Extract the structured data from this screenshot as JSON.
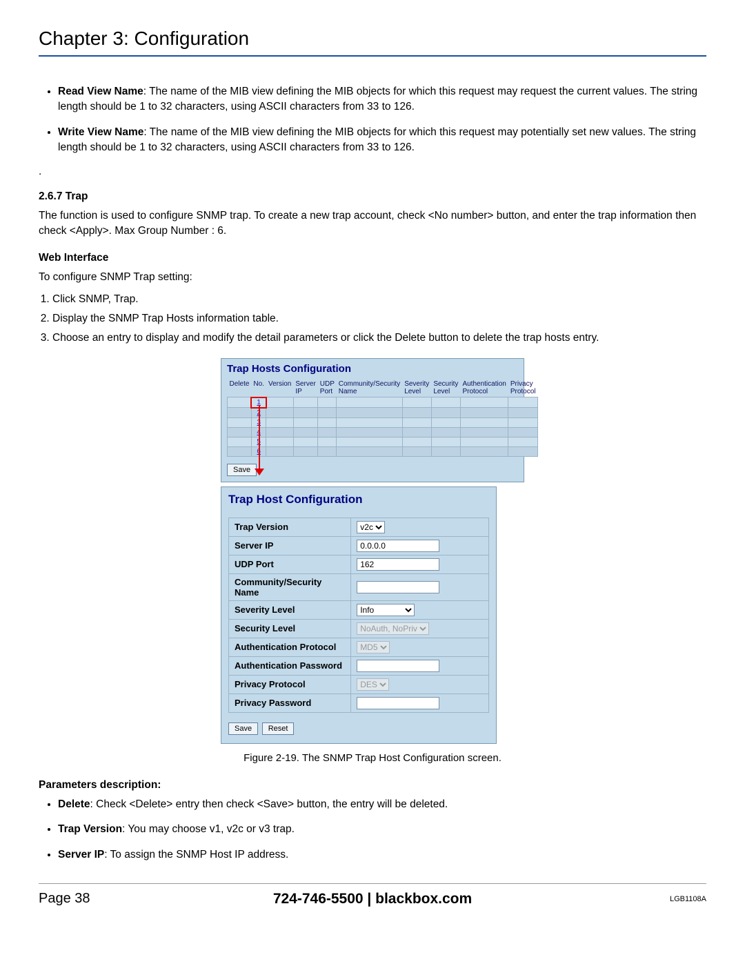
{
  "header": {
    "title": "Chapter 3: Configuration"
  },
  "bullets": {
    "read": {
      "label": "Read View Name",
      "text": ": The name of the MIB view defining the MIB objects for which this request may request the current values. The string length should be 1 to 32 characters, using ASCII characters from 33 to 126."
    },
    "write": {
      "label": "Write View Name",
      "text": ": The name of the MIB view defining the MIB objects for which this request may potentially set new values. The string length should be 1 to 32 characters, using ASCII characters from 33 to 126."
    }
  },
  "dot": ".",
  "sec": {
    "trap_head": "2.6.7 Trap",
    "trap_desc": "The function is used to configure SNMP trap. To create a new trap account, check <No number> button, and enter the trap information then check <Apply>. Max Group Number : 6.",
    "web_head": "Web Interface",
    "web_desc": "To configure SNMP Trap setting:",
    "steps": {
      "s1": "Click SNMP, Trap.",
      "s2": "Display the SNMP Trap Hosts information table.",
      "s3": "Choose an entry to display and modify the detail parameters or click the Delete button to delete the trap hosts entry."
    }
  },
  "fig1": {
    "title": "Trap Hosts Configuration",
    "headers": {
      "h1": "Delete",
      "h2": "No.",
      "h3": "Version",
      "h4": "Server IP",
      "h5": "UDP Port",
      "h6": "Community/Security Name",
      "h7": "Severity Level",
      "h8": "Security Level",
      "h9": "Authentication Protocol",
      "h10": "Privacy Protocol"
    },
    "rows": [
      "1",
      "2",
      "3",
      "4",
      "5",
      "6"
    ],
    "save": "Save"
  },
  "fig2": {
    "title": "Trap Host Configuration",
    "rows": {
      "trap_version": {
        "label": "Trap Version",
        "value": "v2c"
      },
      "server_ip": {
        "label": "Server IP",
        "value": "0.0.0.0"
      },
      "udp_port": {
        "label": "UDP Port",
        "value": "162"
      },
      "community": {
        "label": "Community/Security Name",
        "value": ""
      },
      "severity": {
        "label": "Severity Level",
        "value": "Info"
      },
      "security": {
        "label": "Security Level",
        "value": "NoAuth, NoPriv"
      },
      "auth_proto": {
        "label": "Authentication Protocol",
        "value": "MD5"
      },
      "auth_pass": {
        "label": "Authentication Password",
        "value": ""
      },
      "priv_proto": {
        "label": "Privacy Protocol",
        "value": "DES"
      },
      "priv_pass": {
        "label": "Privacy Password",
        "value": ""
      }
    },
    "save": "Save",
    "reset": "Reset"
  },
  "figcap": "Figure 2-19. The SNMP Trap Host Configuration screen.",
  "params": {
    "head": "Parameters description:",
    "p1_label": "Delete",
    "p1_text": ": Check <Delete> entry then check <Save> button, the entry will be deleted.",
    "p2_label": "Trap Version",
    "p2_text": ": You may choose v1, v2c or v3 trap.",
    "p3_label": "Server IP",
    "p3_text": ": To assign the SNMP Host IP address."
  },
  "footer": {
    "left_page": "Page 38",
    "center": "724-746-5500   |   blackbox.com",
    "right": "LGB1108A"
  }
}
